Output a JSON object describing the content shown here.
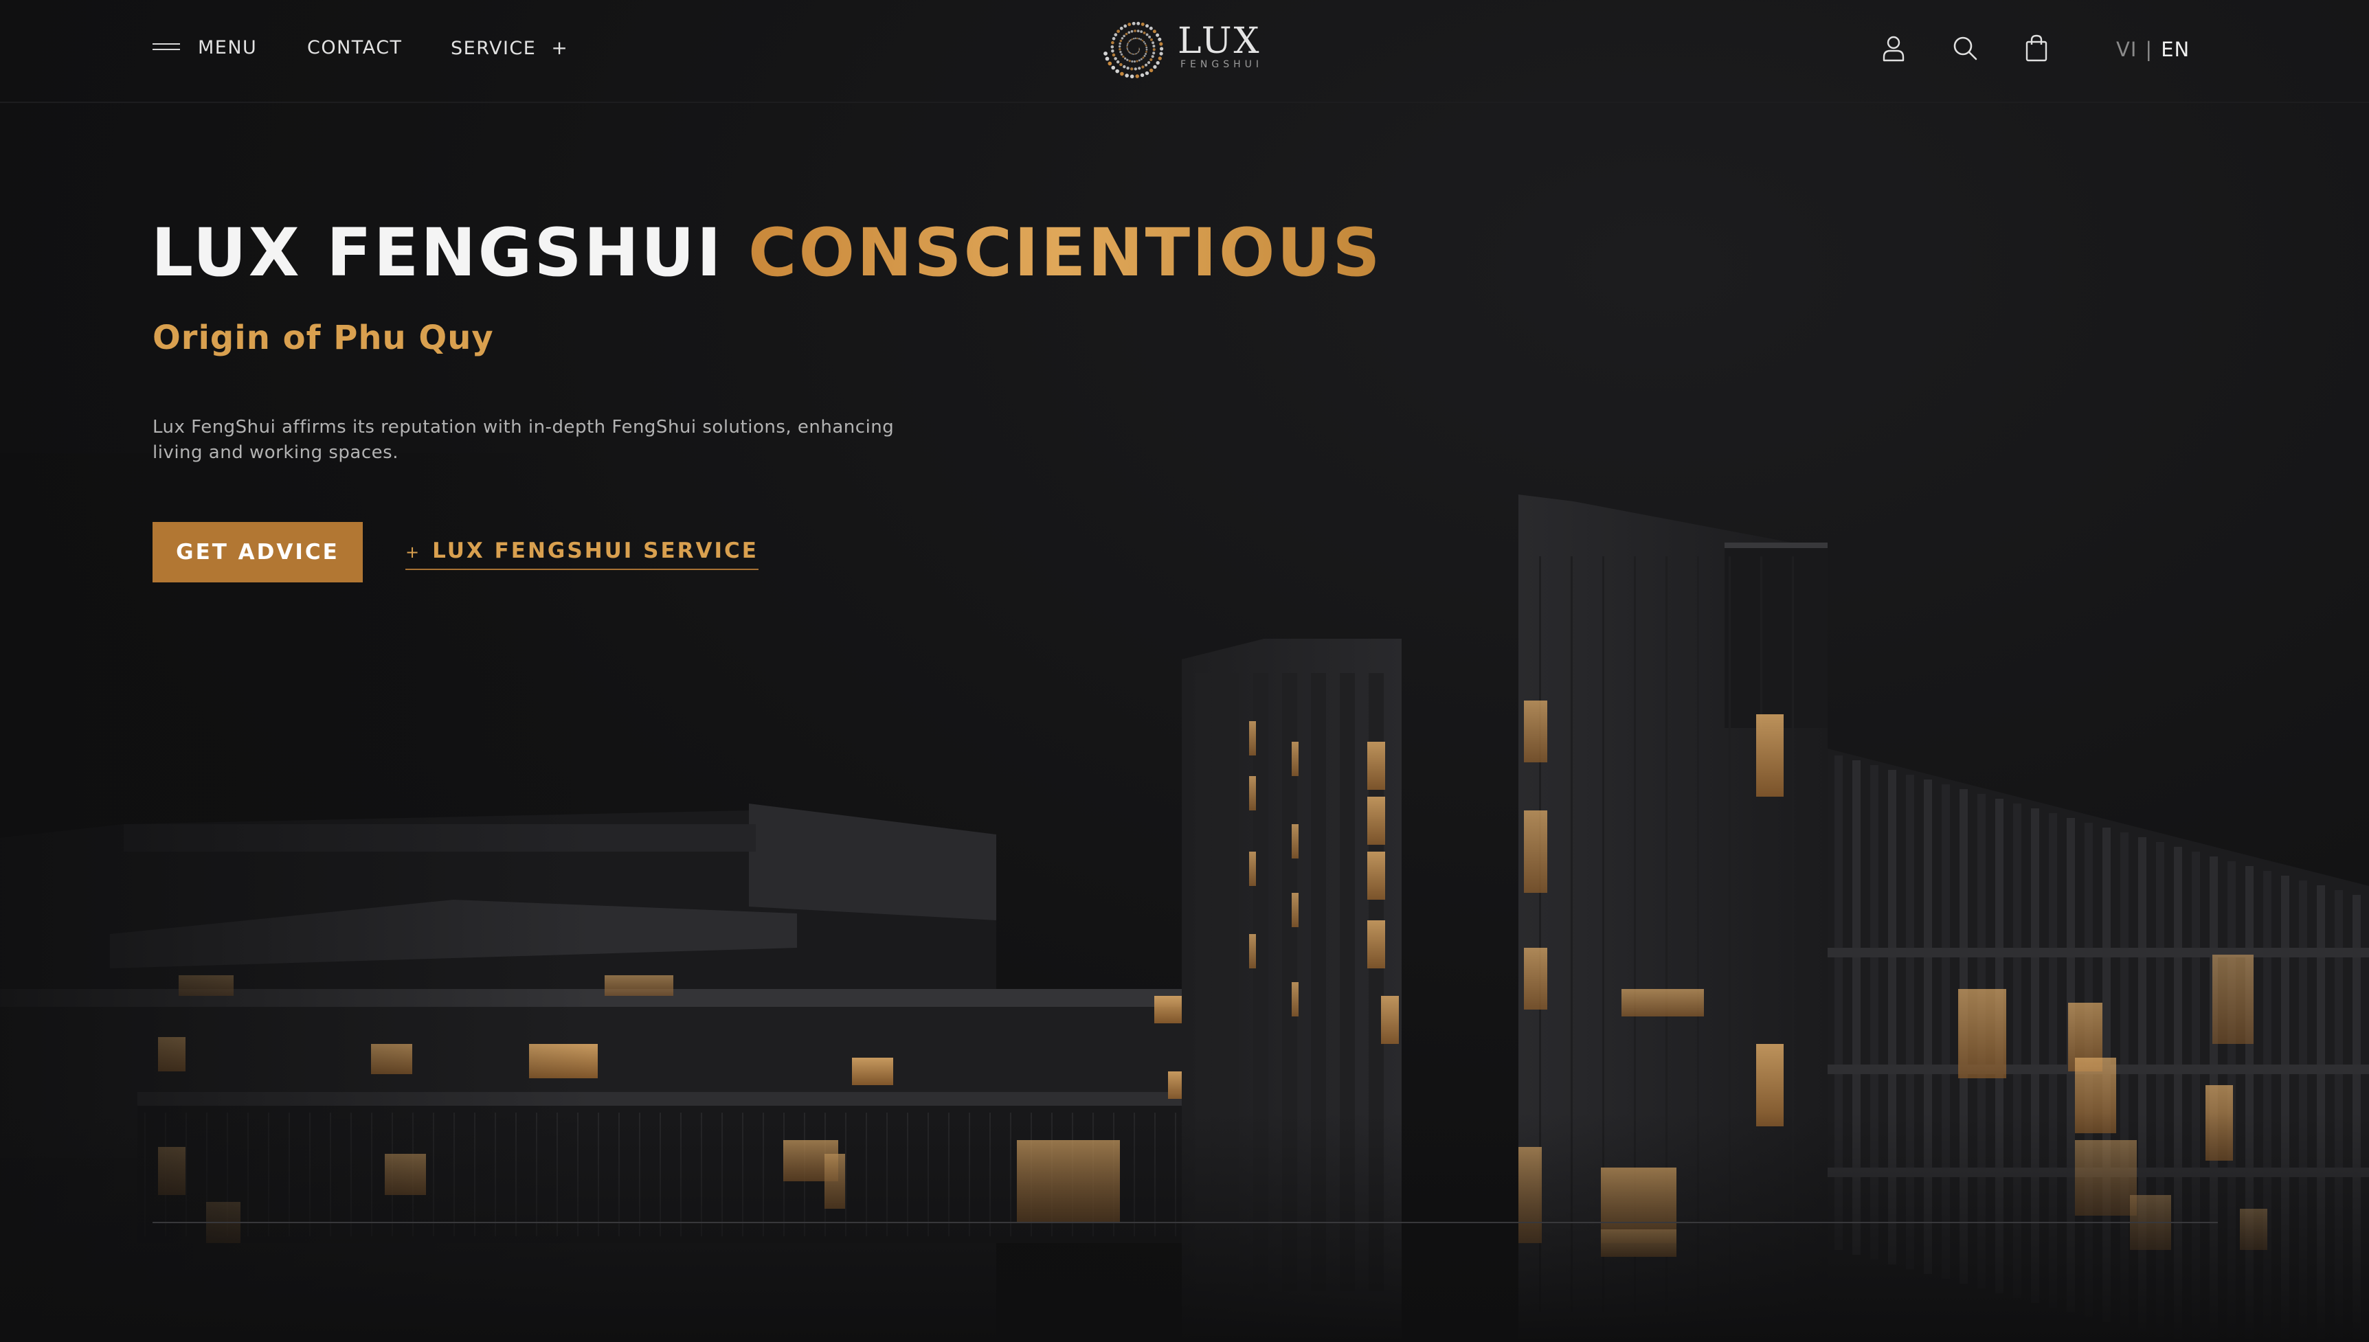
{
  "header": {
    "menu_label": "MENU",
    "contact_label": "CONTACT",
    "service_label": "SERVICE",
    "service_plus": "+",
    "logo_word": "LUX",
    "logo_sub": "FENGSHUI",
    "icons": [
      "user-icon",
      "search-icon",
      "shopping-bag-icon"
    ],
    "lang": {
      "vi": "VI",
      "separator": "|",
      "en": "EN"
    }
  },
  "hero": {
    "title_main": "LUX FENGSHUI",
    "title_accent": "CONSCIENTIOUS",
    "subtitle": "Origin of Phu Quy",
    "description": "Lux FengShui affirms its reputation with in-depth FengShui solutions, enhancing living and working spaces.",
    "primary_button": "GET ADVICE",
    "secondary_plus": "+",
    "secondary_link": "LUX FENGSHUI SERVICE"
  },
  "colors": {
    "background": "#121213",
    "accent_gold": "#d49a4c",
    "button_bg": "#b27733",
    "text_light": "#f4f4f4"
  }
}
